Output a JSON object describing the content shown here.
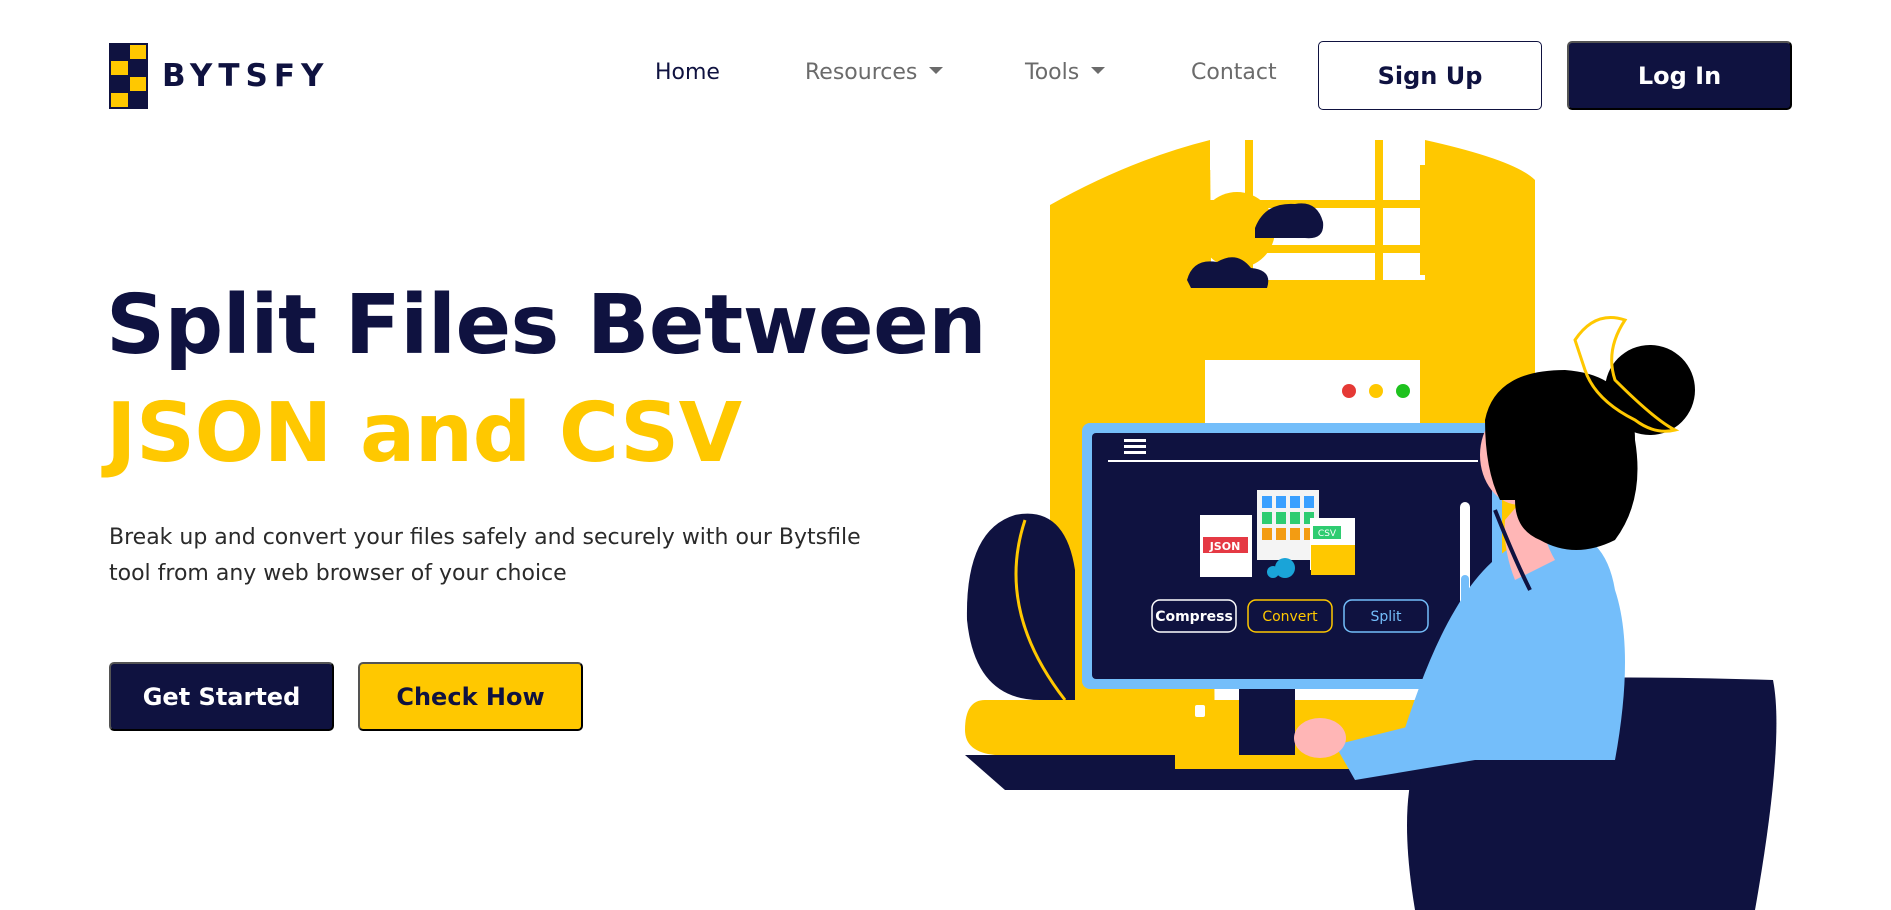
{
  "brand": {
    "name": "BYTSFY"
  },
  "nav": {
    "items": [
      {
        "label": "Home",
        "active": true,
        "dropdown": false
      },
      {
        "label": "Resources",
        "active": false,
        "dropdown": true
      },
      {
        "label": "Tools",
        "active": false,
        "dropdown": true
      },
      {
        "label": "Contact",
        "active": false,
        "dropdown": false
      }
    ],
    "signup_label": "Sign Up",
    "login_label": "Log In"
  },
  "hero": {
    "title_line1": "Split Files Between",
    "title_line2": "JSON and CSV",
    "description": "Break up and convert your files safely and securely with our Bytsfile tool from any web browser of your choice",
    "primary_cta": "Get Started",
    "secondary_cta": "Check How"
  },
  "illustration": {
    "screen_buttons": [
      "Compress",
      "Convert",
      "Split"
    ],
    "file_labels": [
      "JSON",
      "CSV"
    ]
  },
  "colors": {
    "navy": "#0f1240",
    "yellow": "#ffc800",
    "light_blue": "#74befa",
    "gray_text": "#6b6b6b"
  }
}
